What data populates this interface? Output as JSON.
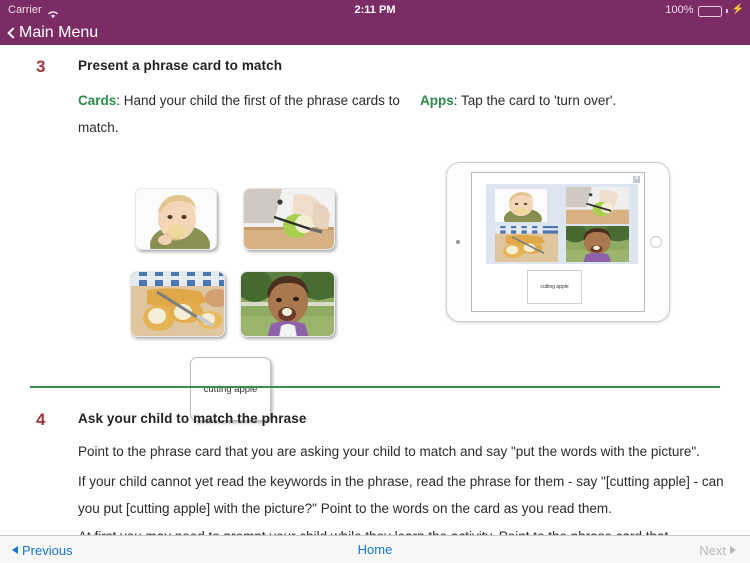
{
  "status_bar": {
    "carrier": "Carrier",
    "wifi_icon": "wifi-icon",
    "time": "2:11 PM",
    "battery_percent": "100%",
    "battery_icon": "battery-full-charging-icon"
  },
  "nav_bar": {
    "back_icon": "chevron-left-icon",
    "back_label": "Main Menu",
    "background_color": "#7C2C64"
  },
  "steps": [
    {
      "number": "3",
      "title": "Present a phrase card to match",
      "cards_label": "Cards",
      "cards_text": ": Hand your child the first of the phrase cards to match.",
      "apps_label": "Apps",
      "apps_text": ": Tap the card to 'turn over'.",
      "photo_cards": [
        {
          "name": "baby-eating-bread",
          "alt": "Baby eating a piece of bread"
        },
        {
          "name": "hands-cutting-apple",
          "alt": "Hands cutting a green apple on a board"
        },
        {
          "name": "cut-bread-loaf",
          "alt": "Sliced bread loaf on a board"
        },
        {
          "name": "child-eating-apple",
          "alt": "Child outdoors eating an apple"
        }
      ],
      "phrase_card_text": "cutting apple",
      "ipad": {
        "name": "ipad-illustration",
        "close_icon": "close-icon",
        "phrase_card_text": "cutting apple",
        "tiles": [
          {
            "name": "baby-eating-bread"
          },
          {
            "name": "hands-cutting-apple"
          },
          {
            "name": "cut-bread-loaf"
          },
          {
            "name": "child-eating-apple"
          }
        ]
      }
    },
    {
      "number": "4",
      "title": "Ask your child to match the phrase",
      "paragraphs": [
        "Point to the phrase card that you are asking your child to match and say \"put the words with the picture\".",
        "If your child cannot yet read the keywords in the phrase, read the phrase for them - say \"[cutting apple] - can you put [cutting apple] with the picture?\" Point to the words on the card as you read them.",
        "At first you may need to prompt your child while they learn the activity. Point to the phrase card that"
      ]
    }
  ],
  "divider_color": "#3D8C48",
  "accent_colors": {
    "step_number": "#A4343A",
    "label_green": "#2E8B4A",
    "link_blue": "#1675E0",
    "disabled_gray": "#B9B9B9"
  },
  "toolbar": {
    "previous_label": "Previous",
    "previous_icon": "triangle-left-icon",
    "home_label": "Home",
    "next_label": "Next",
    "next_icon": "triangle-right-icon",
    "next_disabled": true
  }
}
